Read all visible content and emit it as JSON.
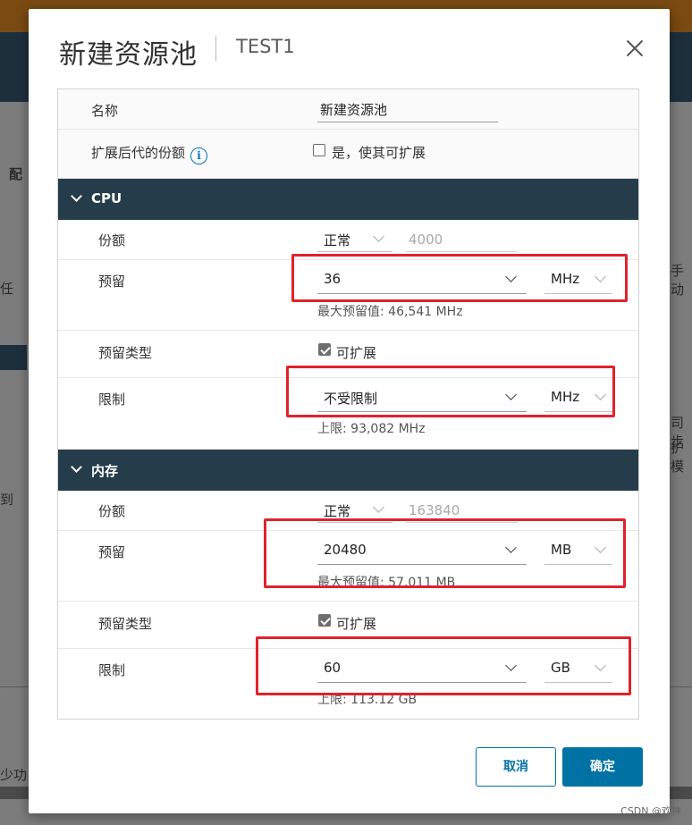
{
  "background": {
    "side_text": [
      "配",
      "任",
      "到",
      "少功",
      "手动",
      "司步",
      "护模"
    ]
  },
  "watermark": "CSDN @欢神",
  "dialog": {
    "title": "新建资源池",
    "subtitle": "TEST1",
    "name_label": "名称",
    "name_value": "新建资源池",
    "expand_label": "扩展后代的份额",
    "expand_checkbox_label": "是，使其可扩展",
    "expand_checked": false,
    "cpu": {
      "section_label": "CPU",
      "shares_label": "份额",
      "shares_select": "正常",
      "shares_value": "4000",
      "reservation_label": "预留",
      "reservation_value": "36",
      "reservation_unit": "MHz",
      "reservation_hint": "最大预留值: 46,541 MHz",
      "reservation_type_label": "预留类型",
      "expandable_label": "可扩展",
      "expandable_checked": true,
      "limit_label": "限制",
      "limit_value": "不受限制",
      "limit_unit": "MHz",
      "limit_hint": "上限: 93,082 MHz"
    },
    "memory": {
      "section_label": "内存",
      "shares_label": "份额",
      "shares_select": "正常",
      "shares_value": "163840",
      "reservation_label": "预留",
      "reservation_value": "20480",
      "reservation_unit": "MB",
      "reservation_hint": "最大预留值: 57,011 MB",
      "reservation_type_label": "预留类型",
      "expandable_label": "可扩展",
      "expandable_checked": true,
      "limit_label": "限制",
      "limit_value": "60",
      "limit_unit": "GB",
      "limit_hint": "上限: 113.12 GB"
    },
    "cancel_label": "取消",
    "ok_label": "确定"
  },
  "colors": {
    "section_header": "#253d4b",
    "primary": "#0072a3",
    "highlight": "#e0222c"
  }
}
